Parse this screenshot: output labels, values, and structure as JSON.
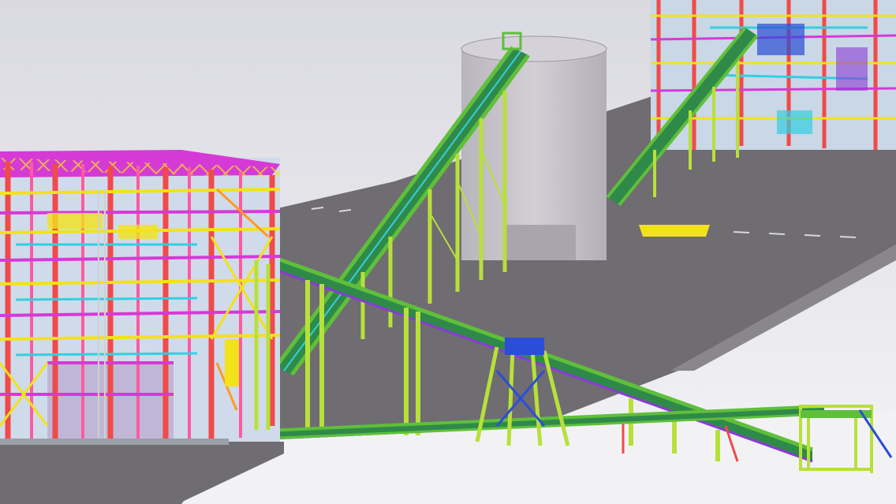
{
  "scene": {
    "description_visible_text": "",
    "colors": {
      "sky_top": "#d7d7de",
      "sky_bottom": "#f4f4f7",
      "ground": "#6f6c72",
      "ground_light": "#8a878c",
      "road_mark": "#d8d8d8",
      "silo": "#c9c6cc",
      "silo_shadow": "#a9a5ad",
      "steel_red": "#f04a4a",
      "steel_magenta": "#d63ad6",
      "steel_pink": "#ff5aa0",
      "steel_yellow": "#f2e21a",
      "steel_orange": "#ff9a1f",
      "steel_green": "#5fbf3a",
      "steel_lime": "#b8e03a",
      "steel_cyan": "#33cfe0",
      "steel_blue": "#2a4fd6",
      "steel_purple": "#8a3ad6",
      "steel_grey": "#9aa0a6"
    }
  }
}
